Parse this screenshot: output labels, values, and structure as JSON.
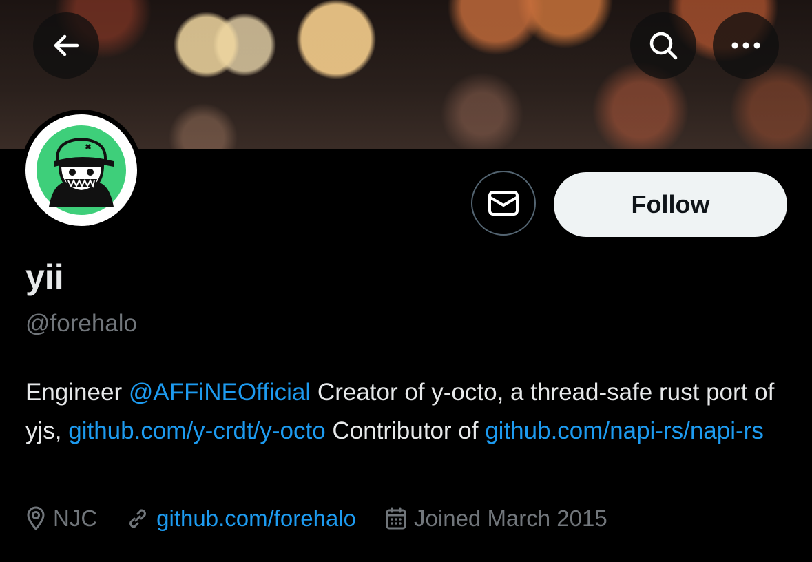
{
  "header": {
    "back_icon": "arrow-left-icon",
    "search_icon": "search-icon",
    "more_icon": "more-horizontal-icon"
  },
  "profile": {
    "display_name": "yii",
    "handle": "@forehalo",
    "bio": {
      "t1": "Engineer ",
      "mention": "@AFFiNEOfficial",
      "t2": " Creator of y-octo, a thread-safe rust port of yjs, ",
      "link1": "github.com/y-crdt/y-octo",
      "t3": " Contributor of ",
      "link2": "github.com/napi-rs/napi-rs"
    },
    "location": "NJC",
    "website": "github.com/forehalo",
    "joined": "Joined March 2015"
  },
  "actions": {
    "message_icon": "envelope-icon",
    "follow_label": "Follow"
  },
  "colors": {
    "background": "#000000",
    "link": "#1d9bf0",
    "secondary_text": "#71767b",
    "follow_bg": "#eff3f4",
    "avatar_green": "#3ecf7a"
  }
}
